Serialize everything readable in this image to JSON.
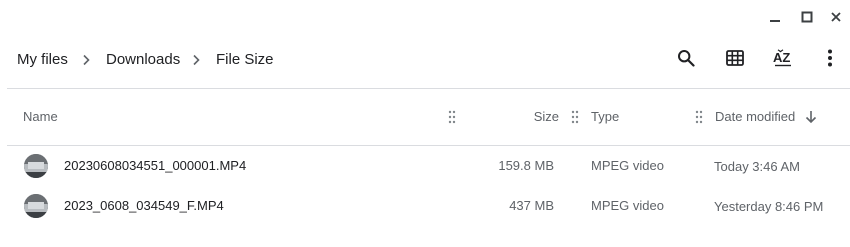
{
  "window": {
    "minimize_icon": "minimize-icon",
    "maximize_icon": "maximize-icon",
    "close_icon": "close-icon"
  },
  "breadcrumb": {
    "items": [
      "My files",
      "Downloads",
      "File Size"
    ]
  },
  "toolbar": {
    "search_icon": "search-icon",
    "grid_view_icon": "grid-view-icon",
    "sort_icon": "sort-az-icon",
    "more_icon": "more-vert-icon"
  },
  "table": {
    "columns": {
      "name": "Name",
      "size": "Size",
      "type": "Type",
      "date": "Date modified"
    },
    "sort_direction_icon": "arrow-down-icon",
    "rows": [
      {
        "name": "20230608034551_000001.MP4",
        "size": "159.8 MB",
        "type": "MPEG video",
        "date": "Today 3:46 AM"
      },
      {
        "name": "2023_0608_034549_F.MP4",
        "size": "437 MB",
        "type": "MPEG video",
        "date": "Yesterday 8:46 PM"
      }
    ]
  },
  "colors": {
    "text": "#202124",
    "secondary_text": "#5f6368",
    "divider": "#dadce0"
  }
}
